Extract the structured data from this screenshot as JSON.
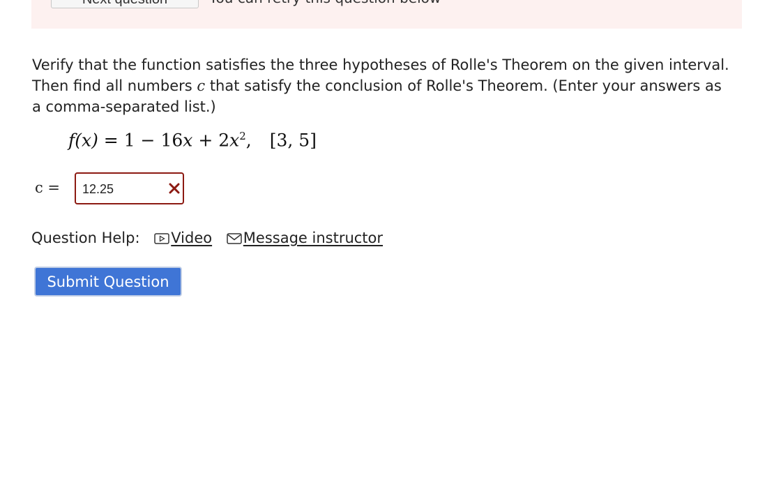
{
  "banner": {
    "next_button_label": "Next question",
    "retry_text": "You can retry this question below"
  },
  "question": {
    "prompt_part1": "Verify that the function satisfies the three hypotheses of Rolle's Theorem on the given interval. Then find all numbers ",
    "variable": "c",
    "prompt_part2": " that satisfy the conclusion of Rolle's Theorem. (Enter your answers as a comma-separated list.)",
    "formula": {
      "lhs": "f(x)",
      "equals": " = ",
      "rhs_a": "1 − 16",
      "rhs_x1": "x",
      "rhs_b": " + 2",
      "rhs_x2": "x",
      "exponent": "2",
      "comma": ",",
      "interval": "[3, 5]"
    }
  },
  "answer": {
    "label": "c =",
    "value": "12.25",
    "status": "incorrect",
    "status_color": "#8c1a12"
  },
  "help": {
    "label": "Question Help:",
    "video_label": "Video",
    "message_label": "Message instructor"
  },
  "submit": {
    "label": "Submit Question",
    "color": "#3f75d6"
  }
}
